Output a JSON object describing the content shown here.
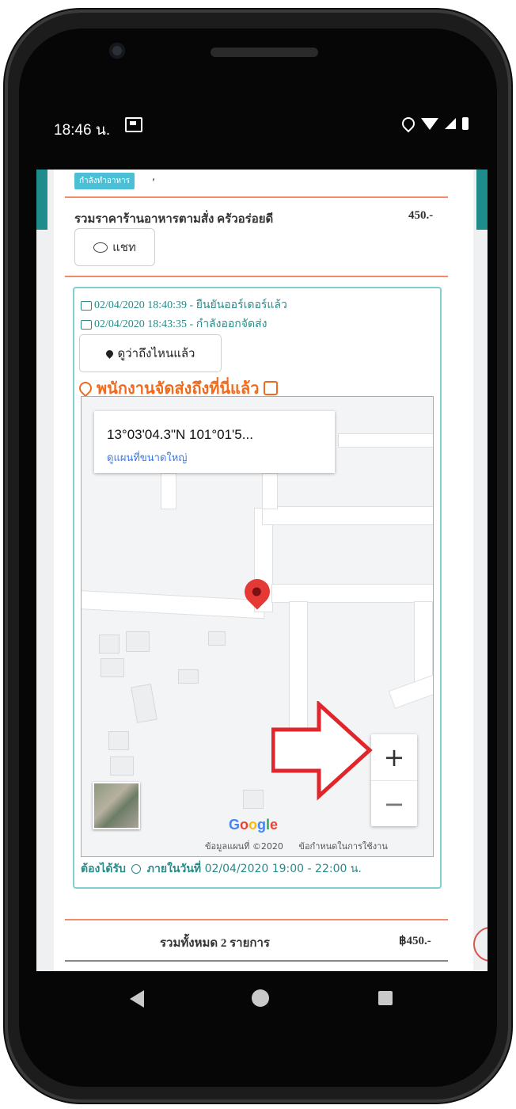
{
  "status_bar": {
    "time": "18:46 น."
  },
  "order": {
    "badge": "กำลังทำอาหาร",
    "comma": ",",
    "summary_label": "รวมราคาร้านอาหารตามสั่ง ครัวอร่อยดี",
    "summary_value": "450.-",
    "chat_label": "แชท"
  },
  "tracking": {
    "log": [
      {
        "text": "02/04/2020 18:40:39 - ยืนยันออร์เดอร์แล้ว"
      },
      {
        "text": "02/04/2020 18:43:35 - กำลังออกจัดส่ง"
      }
    ],
    "where_button": "ดูว่าถึงไหนแล้ว",
    "arrived_text": "พนักงานจัดส่งถึงที่นี่แล้ว",
    "map": {
      "coordinates": "13°03'04.3\"N 101°01'5...",
      "view_larger": "ดูแผนที่ขนาดใหญ่",
      "zoom_in": "+",
      "zoom_out": "−",
      "google_g": "G",
      "google_o1": "o",
      "google_o2": "o",
      "google_g2": "g",
      "google_l": "l",
      "google_e": "e",
      "attribution": "ข้อมูลแผนที่ ©2020",
      "terms": "ข้อกำหนดในการใช้งาน"
    },
    "deliver_prefix": "ต้องได้รับ",
    "deliver_within": "ภายในวันที่",
    "deliver_window": "02/04/2020 19:00 - 22:00 น."
  },
  "totals": {
    "label": "รวมทั้งหมด 2 รายการ",
    "value": "฿450.-"
  }
}
